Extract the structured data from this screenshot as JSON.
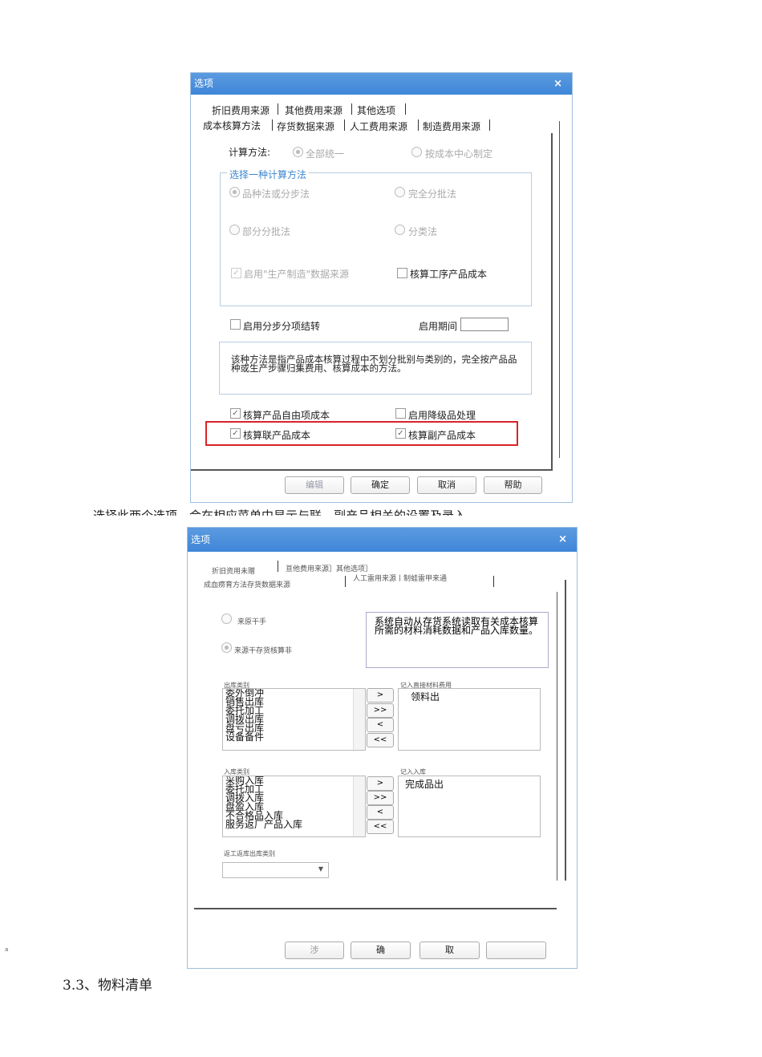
{
  "dialog1": {
    "title": "选项",
    "close": "×",
    "tabs_row1": [
      "折旧费用来源",
      "其他费用来源",
      "其他选项"
    ],
    "tabs_row2": [
      "成本核算方法",
      "存货数据来源",
      "人工费用来源",
      "制造费用来源"
    ],
    "calc_label": "计算方法:",
    "calc_options": [
      "全部统一",
      "按成本中心制定"
    ],
    "group_title": "选择一种计算方法",
    "methods": [
      "品种法或分步法",
      "完全分批法",
      "部分分批法",
      "分类法"
    ],
    "enable_mfg_source": "启用\"生产制造\"数据来源",
    "process_cost": "核算工序产品成本",
    "step_transfer": "启用分步分项结转",
    "enable_period_label": "启用期间",
    "enable_period_value": "",
    "description": "该种方法是指产品成本核算过程中不划分批别与类别的，完全按产品品种或生产步骤归集费用、核算成本的方法。",
    "free_item_cost": "核算产品自由项成本",
    "downgrade": "启用降级品处理",
    "joint_product": "核算联产品成本",
    "by_product": "核算副产品成本",
    "buttons": [
      "编辑",
      "确定",
      "取消",
      "帮助"
    ]
  },
  "caption": "选择此两个选项，会在相应菜单中显示与联、副产品相关的设置及录入",
  "dialog2": {
    "title": "选项",
    "close": "×",
    "tabs_row1": [
      "折旧资用未赠",
      "亘他费用来源］其他选项］"
    ],
    "tabs_row2": [
      "成血痨育方法存货数据来源",
      "人工雷用来源丨制蛙雷甲来通"
    ],
    "radio1": "来原干手",
    "radio2": "来源干存货核算非",
    "description": "系统自动从存货系统读取有关成本核算所需的材料消耗数据和产品入库数量。",
    "out_label": "出库类别",
    "out_items": [
      "委外倒冲",
      "销售出库",
      "委托加工",
      "调拨出库",
      "盘亏出库",
      "设备备件"
    ],
    "out_selected_label": "记入直接材料费用",
    "out_selected": [
      "领料出"
    ],
    "in_label": "入库类别",
    "in_items": [
      "采购入库",
      "委托加工",
      "调拨入库",
      "盘盈入库",
      "不合格品入库",
      "服务返厂产品入库"
    ],
    "in_selected_label": "记入入库",
    "in_selected": [
      "完成品出"
    ],
    "combo_label": "返工返库出库类别",
    "combo_value": "",
    "arrows": [
      ">",
      ">>",
      "<",
      "<<"
    ],
    "buttons": [
      "涉",
      "确",
      "取",
      ""
    ]
  },
  "footer_mark": "a",
  "section_heading": "3.3、物料清单"
}
